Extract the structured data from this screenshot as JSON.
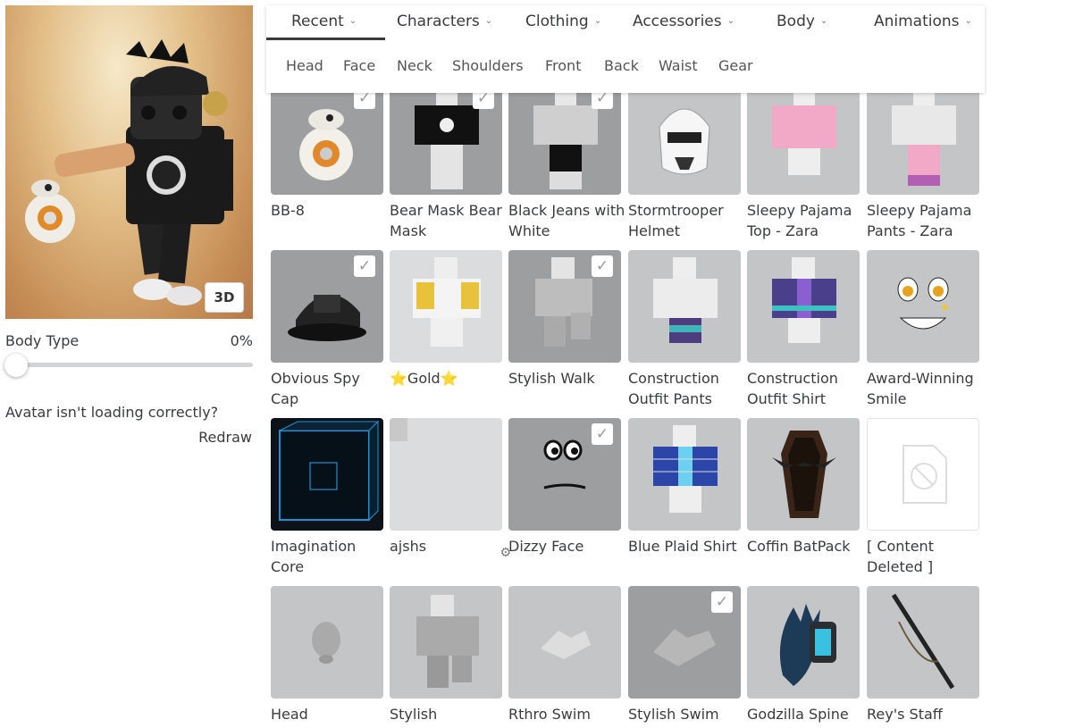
{
  "preview": {
    "view_button": "3D"
  },
  "body_type": {
    "label": "Body Type",
    "value": "0%",
    "level_fraction": 0
  },
  "loading": {
    "message": "Avatar isn't loading correctly?",
    "redraw": "Redraw"
  },
  "nav": {
    "tabs": [
      {
        "label": "Recent",
        "active": true
      },
      {
        "label": "Characters"
      },
      {
        "label": "Clothing"
      },
      {
        "label": "Accessories"
      },
      {
        "label": "Body"
      },
      {
        "label": "Animations"
      }
    ],
    "subtabs": [
      "Head",
      "Face",
      "Neck",
      "Shoulders",
      "Front",
      "Back",
      "Waist",
      "Gear"
    ]
  },
  "items": [
    {
      "name": "BB-8",
      "selected": true,
      "icon": "bb8-droid-icon"
    },
    {
      "name": "Bear Mask Bear Mask",
      "selected": true,
      "icon": "bear-shirt-icon"
    },
    {
      "name": "Black Jeans with White",
      "selected": true,
      "icon": "jeans-avatar-icon"
    },
    {
      "name": "Stormtrooper Helmet",
      "selected": false,
      "icon": "helmet-icon"
    },
    {
      "name": "Sleepy Pajama Top - Zara",
      "selected": false,
      "icon": "pink-top-icon"
    },
    {
      "name": "Sleepy Pajama Pants - Zara",
      "selected": false,
      "icon": "pink-pants-icon"
    },
    {
      "name": "Obvious Spy Cap",
      "selected": true,
      "icon": "spy-cap-icon"
    },
    {
      "name": "⭐Gold⭐",
      "selected": false,
      "icon": "gold-shirt-icon"
    },
    {
      "name": "Stylish Walk",
      "selected": true,
      "icon": "walk-animation-icon"
    },
    {
      "name": "Construction Outfit Pants",
      "selected": false,
      "icon": "outfit-pants-icon"
    },
    {
      "name": "Construction Outfit Shirt",
      "selected": false,
      "icon": "outfit-shirt-icon"
    },
    {
      "name": "Award-Winning Smile",
      "selected": false,
      "icon": "smile-face-icon"
    },
    {
      "name": "Imagination Core",
      "selected": false,
      "icon": "cube-icon"
    },
    {
      "name": "ajshs",
      "selected": false,
      "icon": "blank-icon",
      "has_settings": true
    },
    {
      "name": "Dizzy Face",
      "selected": true,
      "icon": "dizzy-face-icon"
    },
    {
      "name": "Blue Plaid Shirt",
      "selected": false,
      "icon": "plaid-shirt-icon"
    },
    {
      "name": "Coffin BatPack",
      "selected": false,
      "icon": "coffin-icon"
    },
    {
      "name": "[ Content Deleted ]",
      "selected": false,
      "icon": "deleted-content-icon"
    },
    {
      "name": "Head",
      "selected": false,
      "icon": "head-icon"
    },
    {
      "name": "Stylish",
      "selected": false,
      "icon": "pose-avatar-icon"
    },
    {
      "name": "Rthro Swim",
      "selected": false,
      "icon": "swim-animation-icon"
    },
    {
      "name": "Stylish Swim",
      "selected": true,
      "icon": "swim-animation-icon"
    },
    {
      "name": "Godzilla Spine",
      "selected": false,
      "icon": "spine-icon"
    },
    {
      "name": "Rey's Staff",
      "selected": false,
      "icon": "staff-icon"
    }
  ]
}
